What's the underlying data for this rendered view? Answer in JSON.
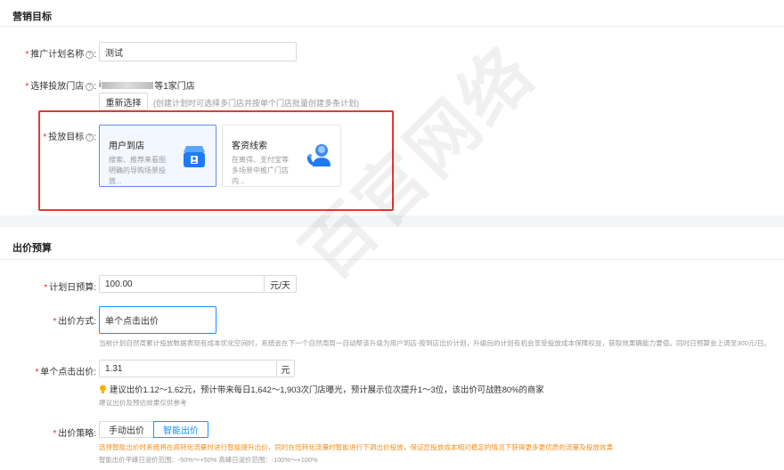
{
  "marketing": {
    "section_title": "营销目标",
    "plan_name": {
      "label": "推广计划名称",
      "value": "测试"
    },
    "stores": {
      "label": "选择投放门店",
      "store_prefix": "i",
      "store_suffix": "等1家门店",
      "reselect_label": "重新选择",
      "reselect_hint": "(创建计划时可选择多门店并按单个门店批量创建多条计划)"
    },
    "goal": {
      "label": "投放目标",
      "cards": [
        {
          "title": "用户到店",
          "desc": "搜索、推荐来看图明确的导购场景投放...",
          "icon": "store-icon",
          "selected": true
        },
        {
          "title": "客资线索",
          "desc": "在离得、支付宝等多场景中推广门店内...",
          "icon": "customer-service-icon",
          "selected": false
        }
      ]
    }
  },
  "bidding": {
    "section_title": "出价预算",
    "daily_budget": {
      "label": "计划日预算",
      "value": "100.00",
      "unit": "元/天"
    },
    "bid_method": {
      "label": "出价方式",
      "value": "单个点击出价",
      "hint": "当前计划自然周累计投放数据表现有成本优化空间时，系统会在下一个自然周周一自动帮该升级为用户到店-按到店出价计划，升级后的计划有机会享受投放成本保障权益，获取效果确能力要值。同时日预算会上调至300元/日。"
    },
    "click_bid": {
      "label": "单个点击出价",
      "value": "1.31",
      "unit": "元",
      "suggestion": "建议出价1.12～1.62元，预计带来每日1,642～1,903次门店曝光，预计展示位次提升1～3位，该出价可战胜80%的商家",
      "suggestion_note": "建议出价及预估效果仅供参考"
    },
    "strategy": {
      "label": "出价策略",
      "options": [
        "手动出价",
        "智能出价"
      ],
      "active": "智能出价",
      "warning": "选择智能出价时系统将在高转化流量时进行智能提升出价，同时在低转化流量时智能进行下调出价投放，保证您投放成本相对稳定的情况下获得更多更优质的流量及投放效果",
      "range_note": "智能出价平峰日溢价范围：-50%～+50% 高峰日溢价范围：-100%～+100%"
    }
  },
  "watermark": "百官网络",
  "colors": {
    "accent": "#1890ff",
    "required": "#f5222d",
    "highlight_box": "#e53935",
    "warning": "#fa8c16"
  }
}
